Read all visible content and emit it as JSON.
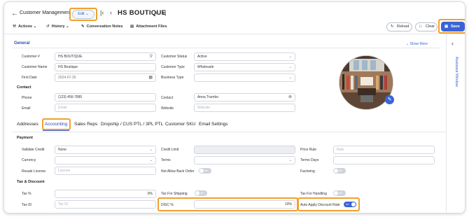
{
  "header": {
    "back_icon": "arrow-left-icon",
    "module_title": "Customer Management",
    "edit_label": "Edit",
    "record_name": "HS BOUTIQUE"
  },
  "toolbar": {
    "actions_label": "Actions",
    "history_label": "History",
    "conversation_notes_label": "Conversation Notes",
    "attachment_files_label": "Attachment Files"
  },
  "buttons": {
    "reload_label": "Reload",
    "clear_label": "Clear",
    "save_label": "Save"
  },
  "right_rail": {
    "label": "Assistant Window"
  },
  "general": {
    "title": "General",
    "show_more": "Show More",
    "customer_no_label": "Customer #",
    "customer_no_value": "HS BOUTIQUE",
    "customer_name_label": "Customer Name",
    "customer_name_value": "HS Boutique",
    "first_date_label": "First Date",
    "first_date_value": "2024-07-26",
    "customer_status_label": "Customer Status",
    "customer_status_value": "Active",
    "customer_type_label": "Customer Type",
    "customer_type_value": "Wholesale",
    "business_type_label": "Business Type",
    "business_type_value": ""
  },
  "contact": {
    "title": "Contact",
    "phone_label": "Phone",
    "phone_value": "(123) 456-7890",
    "email_label": "Email",
    "email_placeholder": "Email",
    "contact_label": "Contact",
    "contact_value": "Anna Trumbo",
    "website_label": "Website",
    "website_placeholder": "Website"
  },
  "tabs": [
    "Addresses",
    "Accounting",
    "Sales Reps",
    "Dropship / CUS PTL / 3PL PTL",
    "Customer SKU",
    "Email Settings"
  ],
  "active_tab": "Accounting",
  "payment": {
    "title": "Payment",
    "validate_credit_label": "Validate Credit",
    "validate_credit_value": "None",
    "currency_label": "Currency",
    "currency_value": "",
    "resale_license_label": "Resale License",
    "resale_license_placeholder": "License",
    "credit_limit_label": "Credit Limit",
    "credit_limit_value": "",
    "terms_label": "Terms",
    "terms_value": "",
    "not_allow_back_order_label": "Not Allow Back Order",
    "not_allow_back_order_state": "off",
    "price_rule_label": "Price Rule",
    "price_rule_placeholder": "Rule",
    "terms_days_label": "Terms Days",
    "terms_days_value": "",
    "factoring_label": "Factoring",
    "factoring_state": "off"
  },
  "tax": {
    "title": "Tax & Discount",
    "tax_pct_label": "Tax %",
    "tax_pct_value": "0%",
    "tax_id_label": "Tax ID",
    "tax_id_placeholder": "Tax ID",
    "tax_for_shipping_label": "Tax For Shipping",
    "tax_for_shipping_state": "off",
    "disc_pct_label": "DISC %",
    "disc_pct_value": "10%",
    "tax_for_handling_label": "Tax For Handling",
    "tax_for_handling_state": "off",
    "auto_apply_discount_label": "Auto Apply Discount Rate",
    "auto_apply_discount_state": "on"
  },
  "colors": {
    "accent": "#3a64d8",
    "highlight": "#f0a030"
  }
}
